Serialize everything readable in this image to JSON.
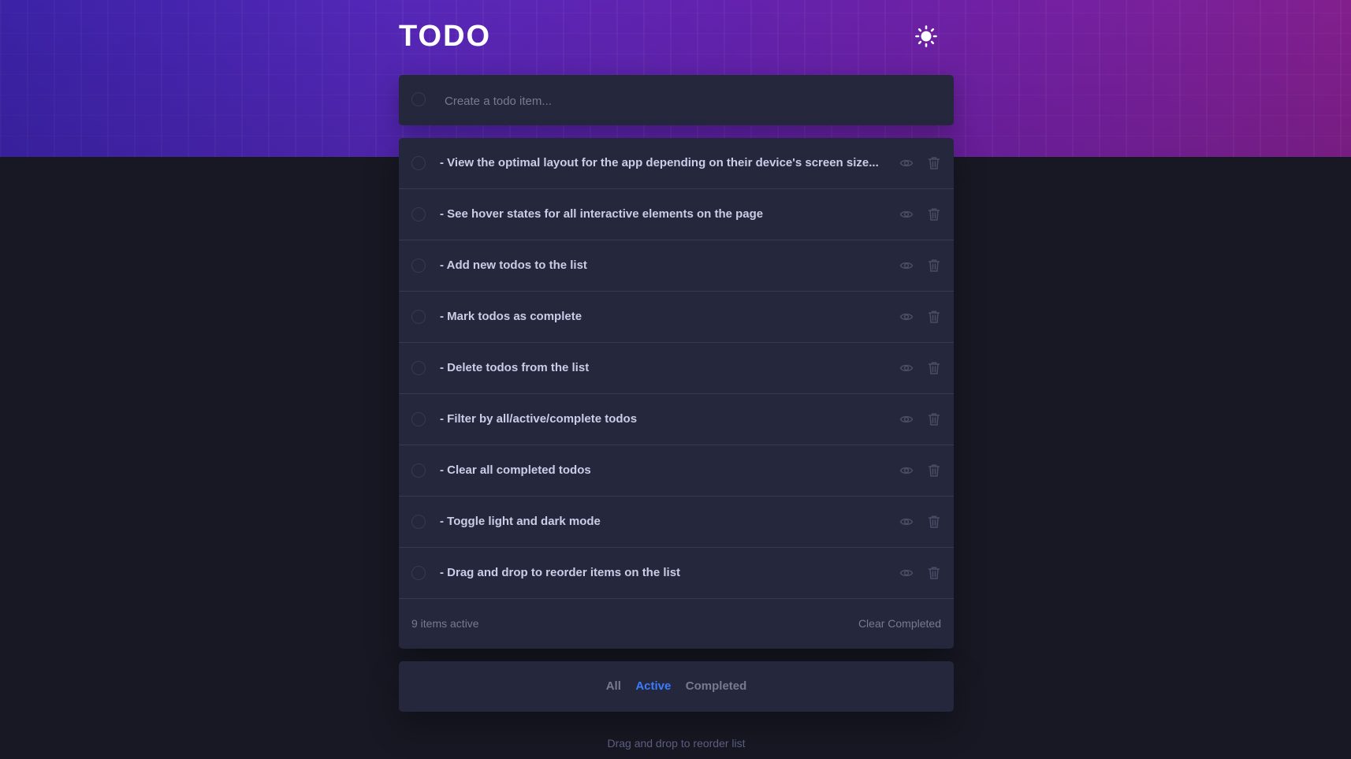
{
  "header": {
    "title": "TODO",
    "theme_icon": "sun-icon"
  },
  "new_todo": {
    "placeholder": "Create a todo item...",
    "value": ""
  },
  "todos": [
    {
      "text": "- View the optimal layout for the app depending on their device's screen size...",
      "completed": false
    },
    {
      "text": "- See hover states for all interactive elements on the page",
      "completed": false
    },
    {
      "text": "- Add new todos to the list",
      "completed": false
    },
    {
      "text": "- Mark todos as complete",
      "completed": false
    },
    {
      "text": "- Delete todos from the list",
      "completed": false
    },
    {
      "text": "- Filter by all/active/complete todos",
      "completed": false
    },
    {
      "text": "- Clear all completed todos",
      "completed": false
    },
    {
      "text": "- Toggle light and dark mode",
      "completed": false
    },
    {
      "text": "- Drag and drop to reorder items on the list",
      "completed": false
    }
  ],
  "item_icons": {
    "view": "eye-icon",
    "delete": "trash-icon"
  },
  "footer": {
    "count_text": "9 items active",
    "clear_label": "Clear Completed"
  },
  "filters": {
    "items": [
      {
        "label": "All",
        "active": false
      },
      {
        "label": "Active",
        "active": true
      },
      {
        "label": "Completed",
        "active": false
      }
    ]
  },
  "hint": "Drag and drop to reorder list",
  "colors": {
    "background": "#181824",
    "panel": "#25273c",
    "text": "#cacde8",
    "muted": "#777a92",
    "accent": "#3a7cfd",
    "gradient_start": "#4a2cc9",
    "gradient_end": "#8a2196"
  }
}
